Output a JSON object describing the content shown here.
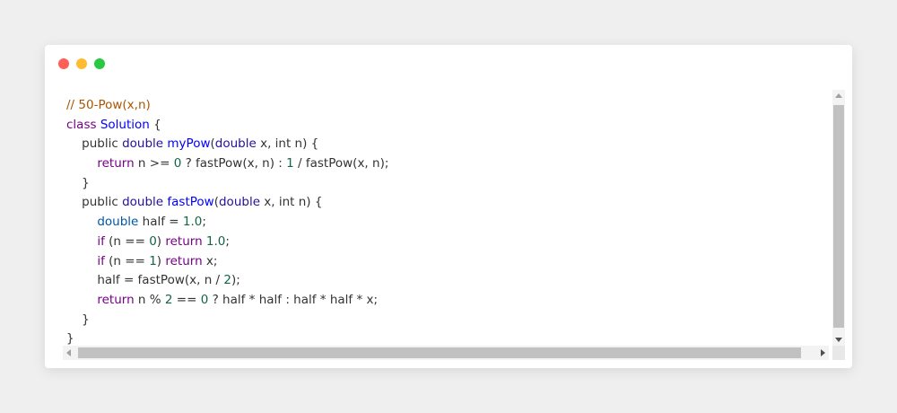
{
  "window": {
    "controls": [
      "close",
      "minimize",
      "maximize"
    ]
  },
  "colors": {
    "comment": "#aa5500",
    "keyword": "#770088",
    "type": "#221199",
    "var_type": "#0055aa",
    "def": "#0000ff",
    "number": "#116644",
    "text": "#333333"
  },
  "code": {
    "language": "java",
    "lines": [
      [
        {
          "t": "comment",
          "v": "// 50-Pow(x,n)"
        }
      ],
      [
        {
          "t": "keyword",
          "v": "class"
        },
        {
          "t": "plain",
          "v": " "
        },
        {
          "t": "def",
          "v": "Solution"
        },
        {
          "t": "plain",
          "v": " {"
        }
      ],
      [
        {
          "t": "plain",
          "v": "    public "
        },
        {
          "t": "type",
          "v": "double"
        },
        {
          "t": "plain",
          "v": " "
        },
        {
          "t": "def",
          "v": "myPow"
        },
        {
          "t": "plain",
          "v": "("
        },
        {
          "t": "type",
          "v": "double"
        },
        {
          "t": "plain",
          "v": " x, int n) {"
        }
      ],
      [
        {
          "t": "plain",
          "v": "        "
        },
        {
          "t": "keyword",
          "v": "return"
        },
        {
          "t": "plain",
          "v": " n >= "
        },
        {
          "t": "number",
          "v": "0"
        },
        {
          "t": "plain",
          "v": " ? fastPow(x, n) : "
        },
        {
          "t": "number",
          "v": "1"
        },
        {
          "t": "plain",
          "v": " / fastPow(x, n);"
        }
      ],
      [
        {
          "t": "plain",
          "v": "    }"
        }
      ],
      [
        {
          "t": "plain",
          "v": "    public "
        },
        {
          "t": "type",
          "v": "double"
        },
        {
          "t": "plain",
          "v": " "
        },
        {
          "t": "def",
          "v": "fastPow"
        },
        {
          "t": "plain",
          "v": "("
        },
        {
          "t": "type",
          "v": "double"
        },
        {
          "t": "plain",
          "v": " x, int n) {"
        }
      ],
      [
        {
          "t": "plain",
          "v": "        "
        },
        {
          "t": "var-type",
          "v": "double"
        },
        {
          "t": "plain",
          "v": " half = "
        },
        {
          "t": "number",
          "v": "1.0"
        },
        {
          "t": "plain",
          "v": ";"
        }
      ],
      [
        {
          "t": "plain",
          "v": "        "
        },
        {
          "t": "keyword",
          "v": "if"
        },
        {
          "t": "plain",
          "v": " (n == "
        },
        {
          "t": "number",
          "v": "0"
        },
        {
          "t": "plain",
          "v": ") "
        },
        {
          "t": "keyword",
          "v": "return"
        },
        {
          "t": "plain",
          "v": " "
        },
        {
          "t": "number",
          "v": "1.0"
        },
        {
          "t": "plain",
          "v": ";"
        }
      ],
      [
        {
          "t": "plain",
          "v": "        "
        },
        {
          "t": "keyword",
          "v": "if"
        },
        {
          "t": "plain",
          "v": " (n == "
        },
        {
          "t": "number",
          "v": "1"
        },
        {
          "t": "plain",
          "v": ") "
        },
        {
          "t": "keyword",
          "v": "return"
        },
        {
          "t": "plain",
          "v": " x;"
        }
      ],
      [
        {
          "t": "plain",
          "v": "        half = fastPow(x, n / "
        },
        {
          "t": "number",
          "v": "2"
        },
        {
          "t": "plain",
          "v": ");"
        }
      ],
      [
        {
          "t": "plain",
          "v": "        "
        },
        {
          "t": "keyword",
          "v": "return"
        },
        {
          "t": "plain",
          "v": " n % "
        },
        {
          "t": "number",
          "v": "2"
        },
        {
          "t": "plain",
          "v": " == "
        },
        {
          "t": "number",
          "v": "0"
        },
        {
          "t": "plain",
          "v": " ? half * half : half * half * x;"
        }
      ],
      [
        {
          "t": "plain",
          "v": "    }"
        }
      ],
      [
        {
          "t": "plain",
          "v": "}"
        }
      ]
    ]
  },
  "scrollbars": {
    "vertical": {
      "arrow_up": "scroll-up-arrow",
      "arrow_down": "scroll-down-arrow"
    },
    "horizontal": {
      "arrow_left": "scroll-left-arrow",
      "arrow_right": "scroll-right-arrow"
    }
  }
}
